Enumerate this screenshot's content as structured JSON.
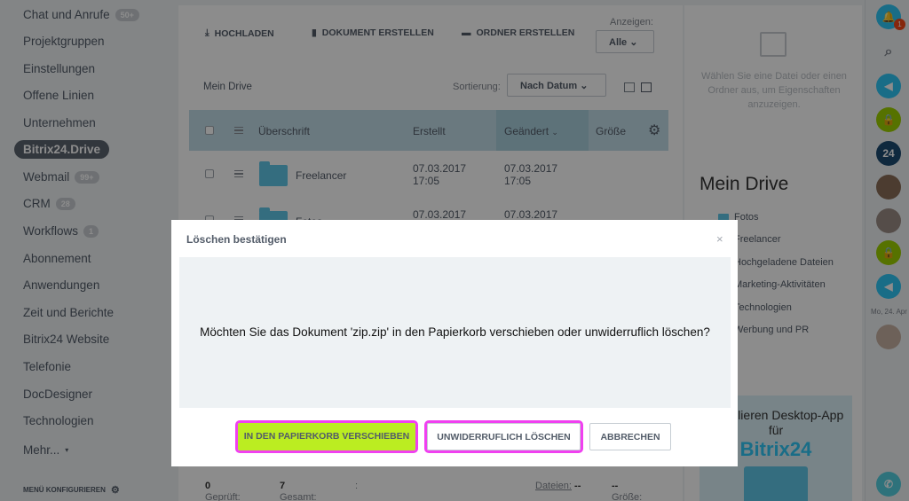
{
  "sidebar": {
    "items": [
      {
        "label": "Chat und Anrufe",
        "badge": "50+"
      },
      {
        "label": "Projektgruppen"
      },
      {
        "label": "Einstellungen"
      },
      {
        "label": "Offene Linien"
      },
      {
        "label": "Unternehmen"
      },
      {
        "label": "Bitrix24.Drive",
        "active": true
      },
      {
        "label": "Webmail",
        "badge": "99+"
      },
      {
        "label": "CRM",
        "badge": "28"
      },
      {
        "label": "Workflows",
        "badge": "1"
      },
      {
        "label": "Abonnement"
      },
      {
        "label": "Anwendungen"
      },
      {
        "label": "Zeit und Berichte"
      },
      {
        "label": "Bitrix24 Website"
      },
      {
        "label": "Telefonie"
      },
      {
        "label": "DocDesigner"
      },
      {
        "label": "Technologien"
      },
      {
        "label": "Mehr..."
      }
    ],
    "configure_label": "MENÜ KONFIGURIEREN"
  },
  "toolbar": {
    "upload_label": "HOCHLADEN",
    "create_doc_label": "DOKUMENT ERSTELLEN",
    "create_folder_label": "ORDNER ERSTELLEN",
    "view_label": "Anzeigen:",
    "view_value": "Alle"
  },
  "list": {
    "breadcrumb": "Mein Drive",
    "sort_label": "Sortierung:",
    "sort_value": "Nach Datum",
    "columns": {
      "title": "Überschrift",
      "created": "Erstellt",
      "modified": "Geändert",
      "size": "Größe"
    },
    "rows": [
      {
        "name": "Freelancer",
        "created_date": "07.03.2017",
        "created_time": "17:05",
        "modified_date": "07.03.2017",
        "modified_time": "17:05"
      },
      {
        "name": "Fotos",
        "created_date": "07.03.2017",
        "created_time": "",
        "modified_date": "07.03.2017",
        "modified_time": ""
      }
    ],
    "footer": {
      "checked_label": "Geprüft:",
      "checked_value": "0",
      "total_label": "Gesamt:",
      "total_value": "7",
      "colon": ":",
      "files_label": "Dateien:",
      "files_value": "--",
      "size_label": "Größe:",
      "size_value": "--"
    }
  },
  "right_panel": {
    "info_text": "Wählen Sie eine Datei oder einen Ordner aus, um Eigenschaften anzuzeigen.",
    "title": "Mein Drive",
    "items": [
      "Fotos",
      "Freelancer",
      "Hochgeladene Dateien",
      "Marketing-Aktivitäten",
      "Technologien",
      "Werbung und PR"
    ],
    "promo_text": "Installieren Desktop-App für",
    "promo_brand": "Bitrix24"
  },
  "right_bar": {
    "notification_count": "1",
    "badge_24": "24",
    "date": "Mo, 24. Apr"
  },
  "dialog": {
    "title": "Löschen bestätigen",
    "close": "×",
    "message": "Möchten Sie das Dokument 'zip.zip' in den Papierkorb verschieben oder unwiderruflich löschen?",
    "btn_trash": "IN DEN PAPIERKORB VERSCHIEBEN",
    "btn_delete": "UNWIDERRUFLICH LÖSCHEN",
    "btn_cancel": "ABBRECHEN"
  }
}
